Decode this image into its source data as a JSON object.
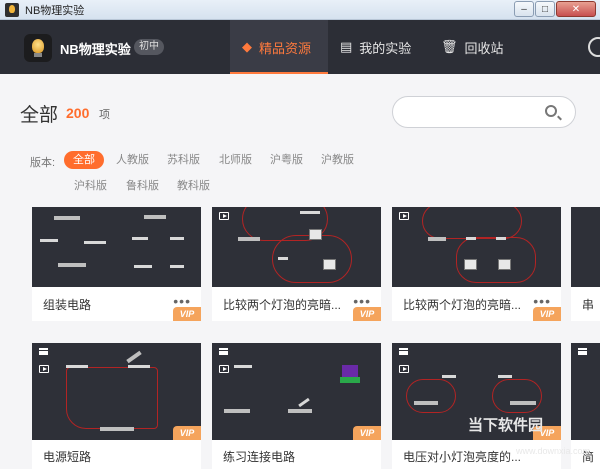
{
  "window": {
    "title": "NB物理实验",
    "minimize": "–",
    "maximize": "□",
    "close": "✕"
  },
  "header": {
    "brand": "NB物理实验",
    "grade": "初中",
    "nav": [
      {
        "label": "精品资源",
        "icon": "diamond-icon",
        "active": true
      },
      {
        "label": "我的实验",
        "icon": "document-icon",
        "active": false
      },
      {
        "label": "回收站",
        "icon": "trash-icon",
        "active": false
      }
    ]
  },
  "summary": {
    "title": "全部",
    "count": "200",
    "unit": "项"
  },
  "search": {
    "placeholder": "",
    "value": ""
  },
  "filter": {
    "label": "版本:",
    "tags": [
      "全部",
      "人教版",
      "苏科版",
      "北师版",
      "沪粤版",
      "沪教版",
      "沪科版",
      "鲁科版",
      "教科版"
    ],
    "selected": "全部"
  },
  "cards": [
    {
      "name": "组装电路",
      "vip": "VIP"
    },
    {
      "name": "比较两个灯泡的亮暗...",
      "vip": "VIP"
    },
    {
      "name": "比较两个灯泡的亮暗...",
      "vip": "VIP"
    },
    {
      "name": "串",
      "vip": ""
    },
    {
      "name": "电源短路",
      "vip": "VIP"
    },
    {
      "name": "练习连接电路",
      "vip": "VIP"
    },
    {
      "name": "电压对小灯泡亮度的...",
      "vip": "VIP"
    },
    {
      "name": "简",
      "vip": ""
    }
  ],
  "more_label": "•••",
  "watermark": {
    "text": "当下软件园",
    "url": "www.downxia.com"
  },
  "colors": {
    "accent": "#ff6d2d",
    "header_bg": "#2c2e36",
    "vip": "#f5a45c"
  }
}
